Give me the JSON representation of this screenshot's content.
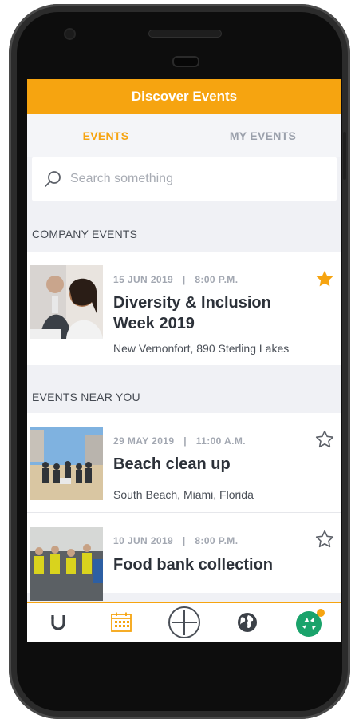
{
  "header": {
    "title": "Discover Events"
  },
  "tabs": [
    {
      "label": "EVENTS",
      "active": true
    },
    {
      "label": "MY EVENTS",
      "active": false
    }
  ],
  "search": {
    "placeholder": "Search something"
  },
  "sections": {
    "company": {
      "label": "COMPANY EVENTS",
      "events": [
        {
          "date": "15 JUN 2019",
          "time": "8:00 P.M.",
          "title_line1": "Diversity & Inclusion",
          "title_line2": "Week 2019",
          "location": "New Vernonfort, 890 Sterling Lakes",
          "starred": true
        }
      ]
    },
    "near": {
      "label": "EVENTS NEAR YOU",
      "events": [
        {
          "date": "29 MAY 2019",
          "time": "11:00 A.M.",
          "title": "Beach clean up",
          "location": "South Beach, Miami, Florida",
          "starred": false
        },
        {
          "date": "10 JUN 2019",
          "time": "8:00 P.M.",
          "title": "Food bank collection",
          "starred": false
        }
      ]
    }
  },
  "separator": "|",
  "nav": {
    "items": [
      {
        "icon": "magnet-icon"
      },
      {
        "icon": "calendar-icon",
        "active": true
      },
      {
        "icon": "add-circle-icon"
      },
      {
        "icon": "globe-icon"
      },
      {
        "icon": "profile-logo-icon",
        "has_notification_dot": true
      }
    ]
  },
  "colors": {
    "accent": "#f6a410",
    "background": "#f0f1f5",
    "text_dark": "#2c3139",
    "text_muted": "#a2a7b1"
  }
}
